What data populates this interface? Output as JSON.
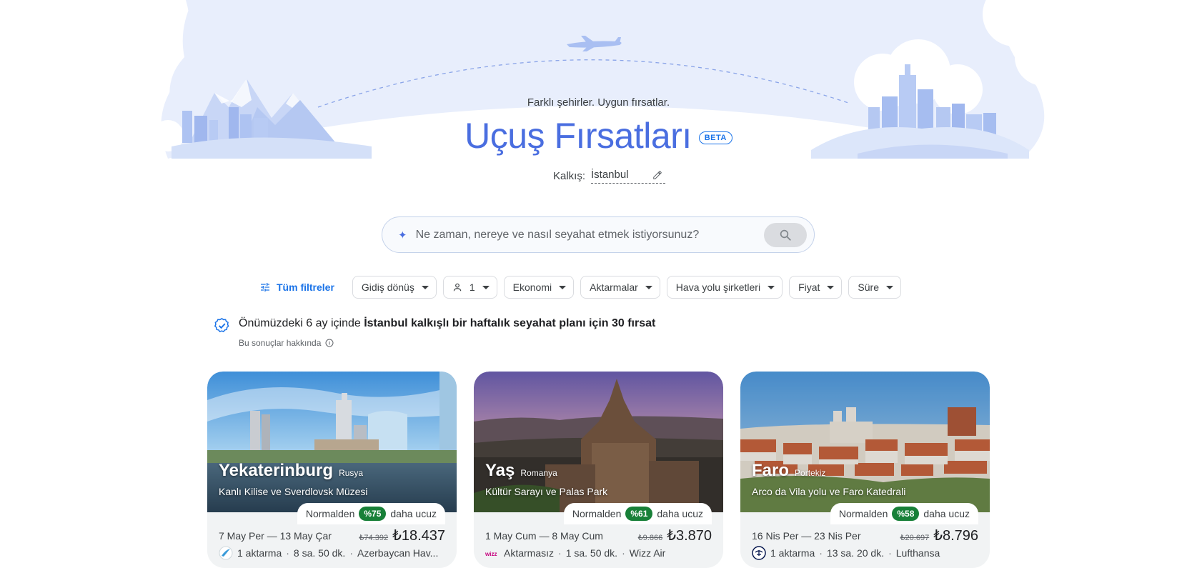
{
  "hero": {
    "tagline": "Farklı şehirler. Uygun fırsatlar.",
    "title": "Uçuş Fırsatları",
    "badge": "BETA",
    "origin_label": "Kalkış:",
    "origin_value": "İstanbul"
  },
  "search": {
    "placeholder": "Ne zaman, nereye ve nasıl seyahat etmek istiyorsunuz?"
  },
  "filters": {
    "all_label": "Tüm filtreler",
    "chips": [
      {
        "label": "Gidiş dönüş"
      },
      {
        "label": "1"
      },
      {
        "label": "Ekonomi"
      },
      {
        "label": "Aktarmalar"
      },
      {
        "label": "Hava yolu şirketleri"
      },
      {
        "label": "Fiyat"
      },
      {
        "label": "Süre"
      }
    ]
  },
  "results": {
    "prefix": "Önümüzdeki 6 ay içinde ",
    "bold": "İstanbul kalkışlı bir haftalık seyahat planı için 30 fırsat",
    "about": "Bu sonuçlar hakkında"
  },
  "cards": [
    {
      "city": "Yekaterinburg",
      "country": "Rusya",
      "landmark": "Kanlı Kilise ve Sverdlovsk Müzesi",
      "deal_prefix": "Normalden",
      "discount": "%75",
      "deal_suffix": "daha ucuz",
      "dates": "7 May Per — 13 May Çar",
      "old_price": "₺74.392",
      "price": "₺18.437",
      "stops": "1 aktarma",
      "duration": "8 sa. 50 dk.",
      "airline": "Azerbaycan Hav...",
      "airline_icon": "azal-logo-icon"
    },
    {
      "city": "Yaş",
      "country": "Romanya",
      "landmark": "Kültür Sarayı ve Palas Park",
      "deal_prefix": "Normalden",
      "discount": "%61",
      "deal_suffix": "daha ucuz",
      "dates": "1 May Cum — 8 May Cum",
      "old_price": "₺9.866",
      "price": "₺3.870",
      "stops": "Aktarmasız",
      "duration": "1 sa. 50 dk.",
      "airline": "Wizz Air",
      "airline_icon": "wizz-logo-icon"
    },
    {
      "city": "Faro",
      "country": "Portekiz",
      "landmark": "Arco da Vila yolu ve Faro Katedrali",
      "deal_prefix": "Normalden",
      "discount": "%58",
      "deal_suffix": "daha ucuz",
      "dates": "16 Nis Per — 23 Nis Per",
      "old_price": "₺20.697",
      "price": "₺8.796",
      "stops": "1 aktarma",
      "duration": "13 sa. 20 dk.",
      "airline": "Lufthansa",
      "airline_icon": "lufthansa-logo-icon"
    }
  ],
  "colors": {
    "accent": "#1a73e8",
    "title": "#4a6ee0",
    "hero_sky": "#e8eefc",
    "discount": "#188038"
  }
}
